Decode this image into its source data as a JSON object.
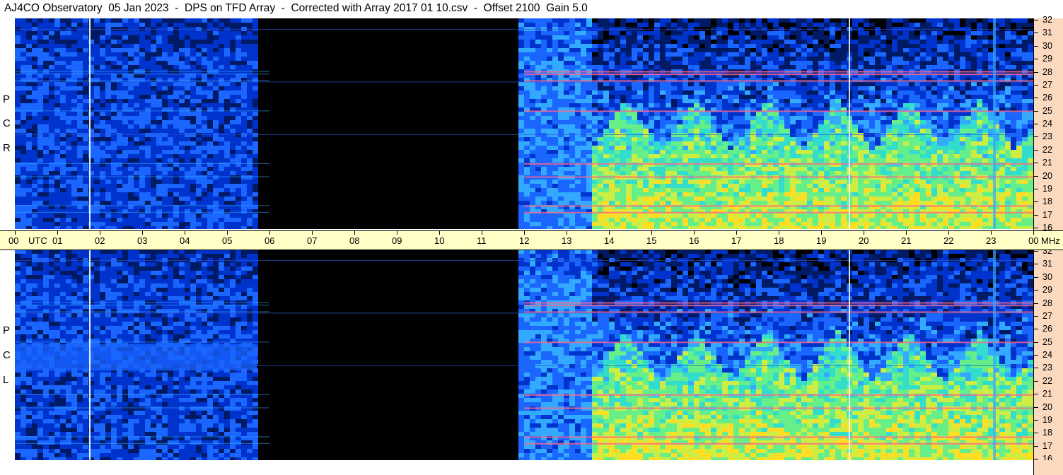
{
  "header": {
    "title": "AJ4CO Observatory  05 Jan 2023  -  DPS on TFD Array  -  Corrected with Array 2017 01 10.csv  -  Offset 2100  Gain 5.0"
  },
  "panels": {
    "top": {
      "polarization_letters": [
        "P",
        "C",
        "R"
      ]
    },
    "bottom": {
      "polarization_letters": [
        "P",
        "C",
        "L"
      ]
    }
  },
  "axis": {
    "time_unit": "UTC",
    "freq_unit": "MHz",
    "time_labels": [
      "00",
      "01",
      "02",
      "03",
      "04",
      "05",
      "06",
      "07",
      "08",
      "09",
      "10",
      "11",
      "12",
      "13",
      "14",
      "15",
      "16",
      "17",
      "18",
      "19",
      "20",
      "21",
      "22",
      "23",
      "00"
    ],
    "freq_labels": [
      "32",
      "31",
      "30",
      "29",
      "28",
      "27",
      "26",
      "25",
      "24",
      "23",
      "22",
      "21",
      "20",
      "19",
      "18",
      "17",
      "16"
    ]
  },
  "chart_data": [
    {
      "type": "heatmap",
      "title": "AJ4CO Observatory  05 Jan 2023  -  DPS on TFD Array  -  Corrected with Array 2017 01 10.csv  -  Offset 2100  Gain 5.0",
      "panel": "RCP",
      "xlabel": "UTC",
      "ylabel": "MHz",
      "xlim": [
        0,
        24
      ],
      "ylim": [
        16,
        32
      ],
      "x_ticks": [
        "00",
        "01",
        "02",
        "03",
        "04",
        "05",
        "06",
        "07",
        "08",
        "09",
        "10",
        "11",
        "12",
        "13",
        "14",
        "15",
        "16",
        "17",
        "18",
        "19",
        "20",
        "21",
        "22",
        "23",
        "00"
      ],
      "y_ticks": [
        16,
        17,
        18,
        19,
        20,
        21,
        22,
        23,
        24,
        25,
        26,
        27,
        28,
        29,
        30,
        31,
        32
      ],
      "colormap": [
        "#000000",
        "#001a66",
        "#0033cc",
        "#1a66ff",
        "#33aaff",
        "#33ddcc",
        "#66ee88",
        "#ccee44",
        "#ffdd22",
        "#ff6688",
        "#ff33aa"
      ],
      "intensity_regions": [
        {
          "x_range": [
            0.0,
            5.7
          ],
          "level": 0.25
        },
        {
          "x_range": [
            5.7,
            11.8
          ],
          "level": 0.03
        },
        {
          "x_range": [
            11.8,
            13.5
          ],
          "level": 0.35
        },
        {
          "x_range": [
            13.5,
            24.0
          ],
          "level": 0.7
        }
      ],
      "interference_bands_mhz": [
        17.3,
        17.8,
        20.0,
        21.0,
        25.0,
        27.3,
        27.8,
        28.0
      ]
    },
    {
      "type": "heatmap",
      "panel": "LCP",
      "xlabel": "UTC",
      "ylabel": "MHz",
      "xlim": [
        0,
        24
      ],
      "ylim": [
        16,
        32
      ],
      "x_ticks": [
        "00",
        "01",
        "02",
        "03",
        "04",
        "05",
        "06",
        "07",
        "08",
        "09",
        "10",
        "11",
        "12",
        "13",
        "14",
        "15",
        "16",
        "17",
        "18",
        "19",
        "20",
        "21",
        "22",
        "23",
        "00"
      ],
      "y_ticks": [
        16,
        17,
        18,
        19,
        20,
        21,
        22,
        23,
        24,
        25,
        26,
        27,
        28,
        29,
        30,
        31,
        32
      ],
      "colormap": [
        "#000000",
        "#001a66",
        "#0033cc",
        "#1a66ff",
        "#33aaff",
        "#33ddcc",
        "#66ee88",
        "#ccee44",
        "#ffdd22",
        "#ff6688",
        "#ff33aa"
      ],
      "intensity_regions": [
        {
          "x_range": [
            0.0,
            5.7
          ],
          "level": 0.25
        },
        {
          "x_range": [
            5.7,
            11.8
          ],
          "level": 0.03
        },
        {
          "x_range": [
            11.8,
            13.5
          ],
          "level": 0.35
        },
        {
          "x_range": [
            13.5,
            24.0
          ],
          "level": 0.7
        }
      ],
      "broadband_emission": {
        "x_range": [
          0.0,
          5.7
        ],
        "y_range": [
          22.8,
          24.8
        ]
      },
      "interference_bands_mhz": [
        17.3,
        17.8,
        20.0,
        21.0,
        25.0,
        27.3,
        27.8,
        28.0
      ]
    }
  ]
}
